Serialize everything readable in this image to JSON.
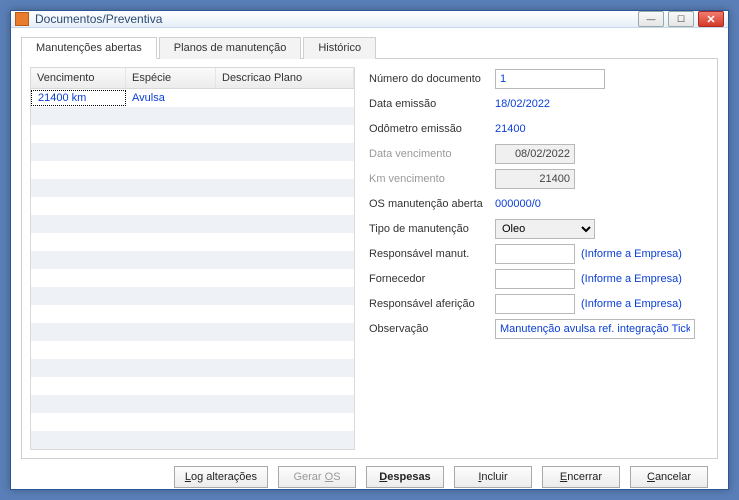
{
  "window": {
    "title": "Documentos/Preventiva"
  },
  "tabs": {
    "open": {
      "label": "Manutenções abertas"
    },
    "plans": {
      "label": "Planos de manutenção"
    },
    "hist": {
      "label": "Histórico"
    }
  },
  "grid": {
    "headers": {
      "venc": "Vencimento",
      "esp": "Espécie",
      "desc": "Descricao Plano"
    },
    "row0": {
      "venc": "21400 km",
      "esp": "Avulsa",
      "desc": ""
    }
  },
  "form": {
    "doc_label": "Número do documento",
    "doc_value": "1",
    "emiss_label": "Data emissão",
    "emiss_value": "18/02/2022",
    "odom_label": "Odômetro emissão",
    "odom_value": "21400",
    "dvenc_label": "Data vencimento",
    "dvenc_value": "08/02/2022",
    "kmvenc_label": "Km vencimento",
    "kmvenc_value": "21400",
    "os_label": "OS manutenção aberta",
    "os_value": "000000/0",
    "tipo_label": "Tipo de manutenção",
    "tipo_value": "Oleo",
    "respm_label": "Responsável manut.",
    "respm_hint": "(Informe a Empresa)",
    "forn_label": "Fornecedor",
    "forn_hint": "(Informe a Empresa)",
    "respa_label": "Responsável aferição",
    "respa_hint": "(Informe a Empresa)",
    "obs_label": "Observação",
    "obs_value": "Manutenção avulsa ref. integração Ticket Log."
  },
  "buttons": {
    "log": "Log alterações",
    "geraros": "Gerar OS",
    "despesas": "Despesas",
    "incluir": "Incluir",
    "encerrar": "Encerrar",
    "cancelar": "Cancelar"
  }
}
